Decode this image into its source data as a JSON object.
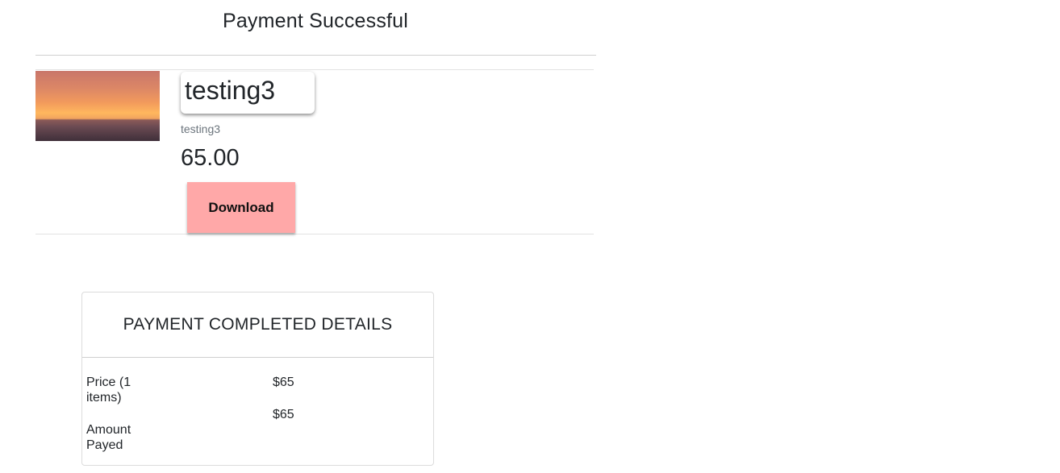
{
  "page": {
    "title": "Payment Successful"
  },
  "product": {
    "name": "testing3",
    "subtitle": "testing3",
    "price": "65.00",
    "download_label": "Download",
    "colors": {
      "download_button": "#ffa8a8"
    }
  },
  "details": {
    "heading": "PAYMENT COMPLETED DETAILS",
    "rows": [
      {
        "label": "Price (1 items)",
        "value": "$65"
      },
      {
        "label": "Amount Payed",
        "value": "$65"
      }
    ]
  }
}
